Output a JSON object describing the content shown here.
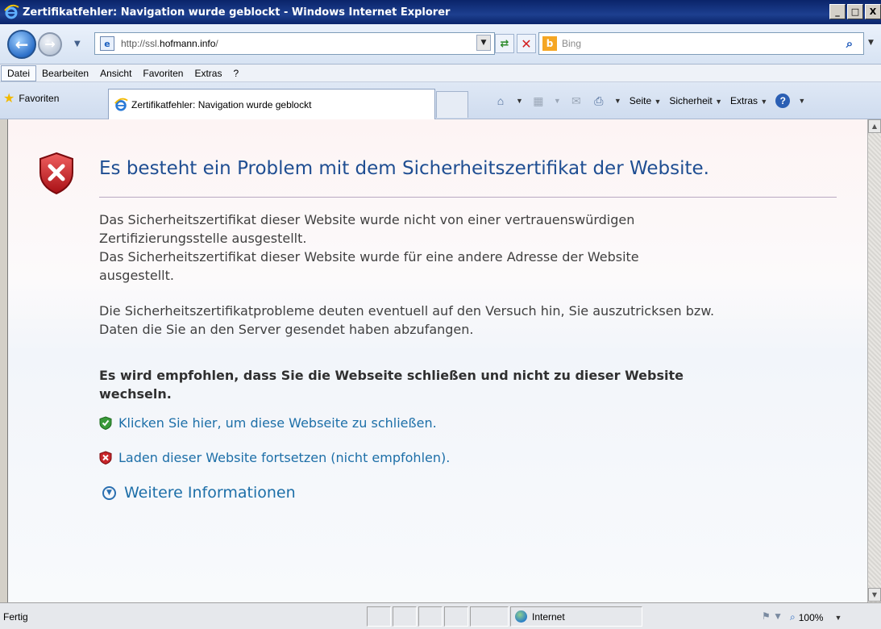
{
  "window": {
    "title": "Zertifikatfehler: Navigation wurde geblockt - Windows Internet Explorer",
    "minimize": "_",
    "maximize": "□",
    "close": "X"
  },
  "address_bar": {
    "url_prefix": "http://ssl.",
    "url_host": "hofmann.info",
    "url_suffix": "/"
  },
  "search": {
    "placeholder": "Bing",
    "icon": "b"
  },
  "menu": [
    "Datei",
    "Bearbeiten",
    "Ansicht",
    "Favoriten",
    "Extras",
    "?"
  ],
  "favorites_bar": {
    "favorites_label": "Favoriten",
    "tab_title": "Zertifikatfehler: Navigation wurde geblockt"
  },
  "command_bar": {
    "page": "Seite",
    "safety": "Sicherheit",
    "tools": "Extras"
  },
  "content": {
    "heading": "Es besteht ein Problem mit dem Sicherheitszertifikat der Website.",
    "para1_line1": "Das Sicherheitszertifikat dieser Website wurde nicht von einer vertrauenswürdigen",
    "para1_line2": "Zertifizierungsstelle ausgestellt.",
    "para1_line3": "Das Sicherheitszertifikat dieser Website wurde für eine andere Adresse der Website",
    "para1_line4": "ausgestellt.",
    "para2_line1": "Die Sicherheitszertifikatprobleme deuten eventuell auf den Versuch hin, Sie auszutricksen bzw.",
    "para2_line2": "Daten die Sie an den Server gesendet haben abzufangen.",
    "recommend_line1": "Es wird empfohlen, dass Sie die Webseite schließen und nicht zu dieser Website",
    "recommend_line2": "wechseln.",
    "close_link": "Klicken Sie hier, um diese Webseite zu schließen.",
    "continue_link": "Laden dieser Website fortsetzen (nicht empfohlen).",
    "more_info": "Weitere Informationen"
  },
  "status_bar": {
    "status": "Fertig",
    "zone": "Internet",
    "zoom": "100%"
  },
  "colors": {
    "heading": "#1f4e92",
    "link": "#1d6fa8",
    "error_red": "#c8262b",
    "ok_green": "#3a9a3a"
  }
}
